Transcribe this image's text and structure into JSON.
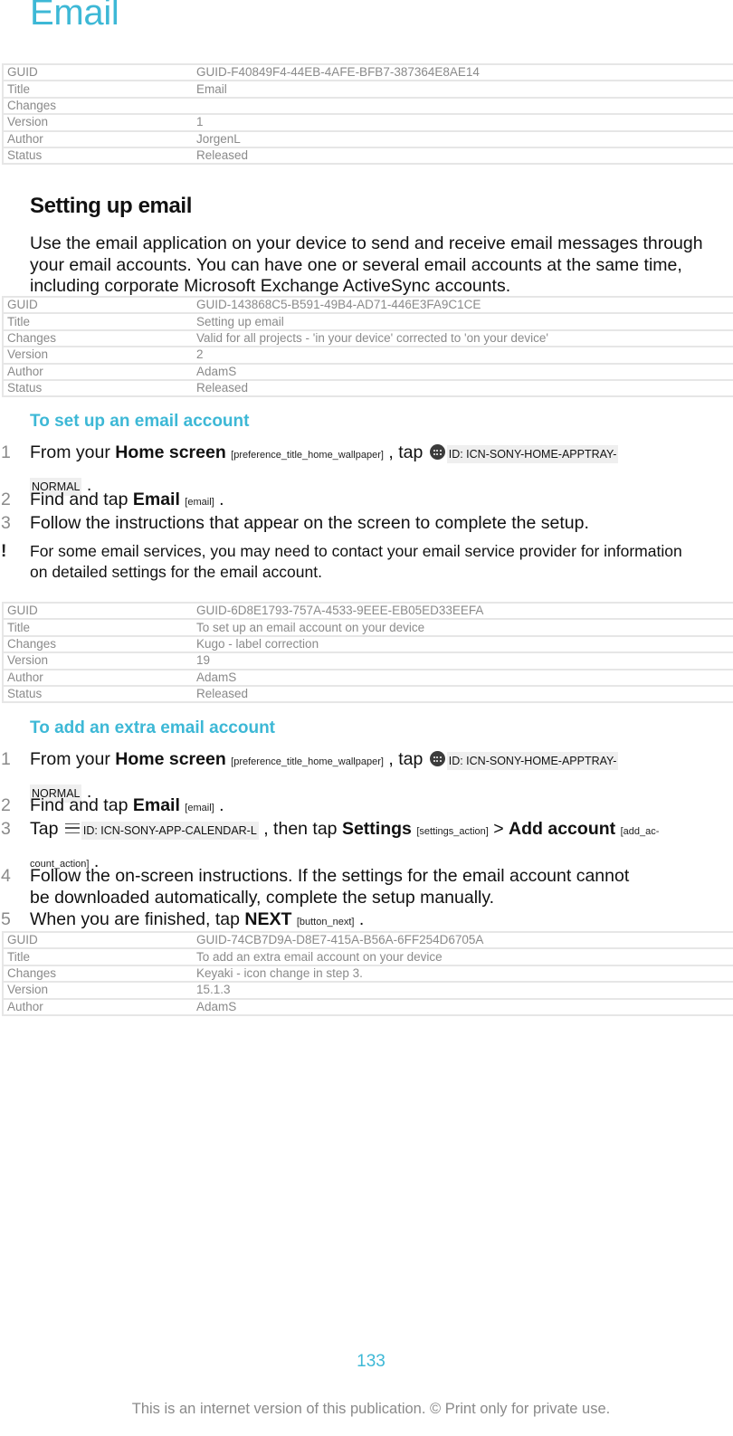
{
  "title": "Email",
  "tables": [
    {
      "rows": [
        {
          "key": "GUID",
          "value": "GUID-F40849F4-44EB-4AFE-BFB7-387364E8AE14"
        },
        {
          "key": "Title",
          "value": "Email"
        },
        {
          "key": "Changes",
          "value": ""
        },
        {
          "key": "Version",
          "value": "1"
        },
        {
          "key": "Author",
          "value": "JorgenL"
        },
        {
          "key": "Status",
          "value": "Released"
        }
      ]
    },
    {
      "rows": [
        {
          "key": "GUID",
          "value": "GUID-143868C5-B591-49B4-AD71-446E3FA9C1CE"
        },
        {
          "key": "Title",
          "value": "Setting up email"
        },
        {
          "key": "Changes",
          "value": "Valid for all projects - 'in your device' corrected to 'on your device'"
        },
        {
          "key": "Version",
          "value": "2"
        },
        {
          "key": "Author",
          "value": "AdamS"
        },
        {
          "key": "Status",
          "value": "Released"
        }
      ]
    },
    {
      "rows": [
        {
          "key": "GUID",
          "value": "GUID-6D8E1793-757A-4533-9EEE-EB05ED33EEFA"
        },
        {
          "key": "Title",
          "value": "To set up an email account on your device"
        },
        {
          "key": "Changes",
          "value": "Kugo - label correction"
        },
        {
          "key": "Version",
          "value": "19"
        },
        {
          "key": "Author",
          "value": "AdamS"
        },
        {
          "key": "Status",
          "value": "Released"
        }
      ]
    },
    {
      "rows": [
        {
          "key": "GUID",
          "value": "GUID-74CB7D9A-D8E7-415A-B56A-6FF254D6705A"
        },
        {
          "key": "Title",
          "value": "To add an extra email account on your device"
        },
        {
          "key": "Changes",
          "value": "Keyaki - icon change in step 3."
        },
        {
          "key": "Version",
          "value": "15.1.3"
        },
        {
          "key": "Author",
          "value": "AdamS"
        }
      ]
    }
  ],
  "section": {
    "heading": "Setting up email",
    "paragraph": "Use the email application on your device to send and receive email messages through your email accounts. You can have one or several email accounts at the same time, including corporate Microsoft Exchange ActiveSync accounts."
  },
  "setup": {
    "heading": "To set up an email account",
    "steps": [
      {
        "num": "1",
        "pre": "From your ",
        "bold": "Home screen",
        "tag": "[preference_title_home_wallpaper]",
        "mid": " , tap ",
        "icon_id": "ID: ICN-SONY-HOME-APPTRAY-",
        "icon_id_2": "NORMAL",
        "end": " ."
      },
      {
        "num": "2",
        "pre": "Find and tap ",
        "bold": "Email",
        "tag": "[email]",
        "end": " ."
      },
      {
        "num": "3",
        "text": "Follow the instructions that appear on the screen to complete the setup."
      }
    ],
    "note_icon": "exclamation-icon",
    "note": "For some email services, you may need to contact your email service provider for information",
    "note_line2": "on detailed settings for the email account."
  },
  "extra": {
    "heading": "To add an extra email account",
    "steps": [
      {
        "num": "1",
        "pre": "From your ",
        "bold": "Home screen",
        "tag": "[preference_title_home_wallpaper]",
        "mid": " , tap ",
        "icon_id": "ID: ICN-SONY-HOME-APPTRAY-",
        "icon_id_2": "NORMAL",
        "end": " ."
      },
      {
        "num": "2",
        "pre": "Find and tap ",
        "bold": "Email",
        "tag": "[email]",
        "end": " ."
      },
      {
        "num": "3",
        "pre": "Tap ",
        "icon_id": "ID: ICN-SONY-APP-CALENDAR-L",
        "mid": " , then tap ",
        "bold": "Settings",
        "tag": "[settings_action]",
        "sep": " > ",
        "bold2": "Add account",
        "tag2": "[add_ac-",
        "tag2b": "count_action]",
        "end": " ."
      },
      {
        "num": "4",
        "text": "Follow the on-screen instructions. If the settings for the email account cannot",
        "text2": "be downloaded automatically, complete the setup manually."
      },
      {
        "num": "5",
        "pre": "When you are finished, tap ",
        "bold": "NEXT",
        "tag": "[button_next]",
        "end": " ."
      }
    ]
  },
  "footer": {
    "page_number": "133",
    "notice": "This is an internet version of this publication. © Print only for private use."
  }
}
